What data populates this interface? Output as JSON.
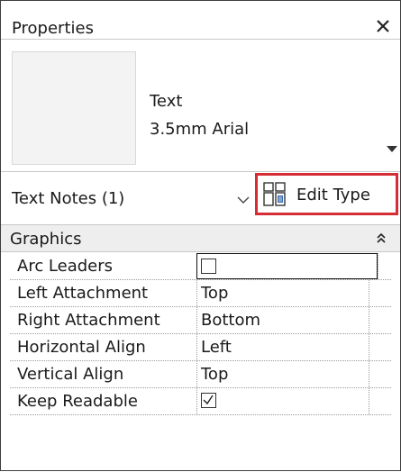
{
  "window": {
    "title": "Properties"
  },
  "type_selector": {
    "family": "Text",
    "type": "3.5mm Arial"
  },
  "instance_filter": {
    "label": "Text Notes (1)"
  },
  "toolbar": {
    "edit_type_label": "Edit Type"
  },
  "section": {
    "title": "Graphics"
  },
  "properties": [
    {
      "name": "Arc Leaders",
      "checkbox": true,
      "checked": false
    },
    {
      "name": "Left Attachment",
      "value": "Top"
    },
    {
      "name": "Right Attachment",
      "value": "Bottom"
    },
    {
      "name": "Horizontal Align",
      "value": "Left"
    },
    {
      "name": "Vertical Align",
      "value": "Top"
    },
    {
      "name": "Keep Readable",
      "checkbox": true,
      "checked": true
    }
  ],
  "colors": {
    "highlight_border": "#d62d35",
    "section_bg": "#eeeeee"
  },
  "icons": [
    "close-icon",
    "dropdown-arrow-icon",
    "chevron-down-icon",
    "edit-type-icon",
    "collapse-icon",
    "checkbox",
    "checkmark-icon"
  ]
}
